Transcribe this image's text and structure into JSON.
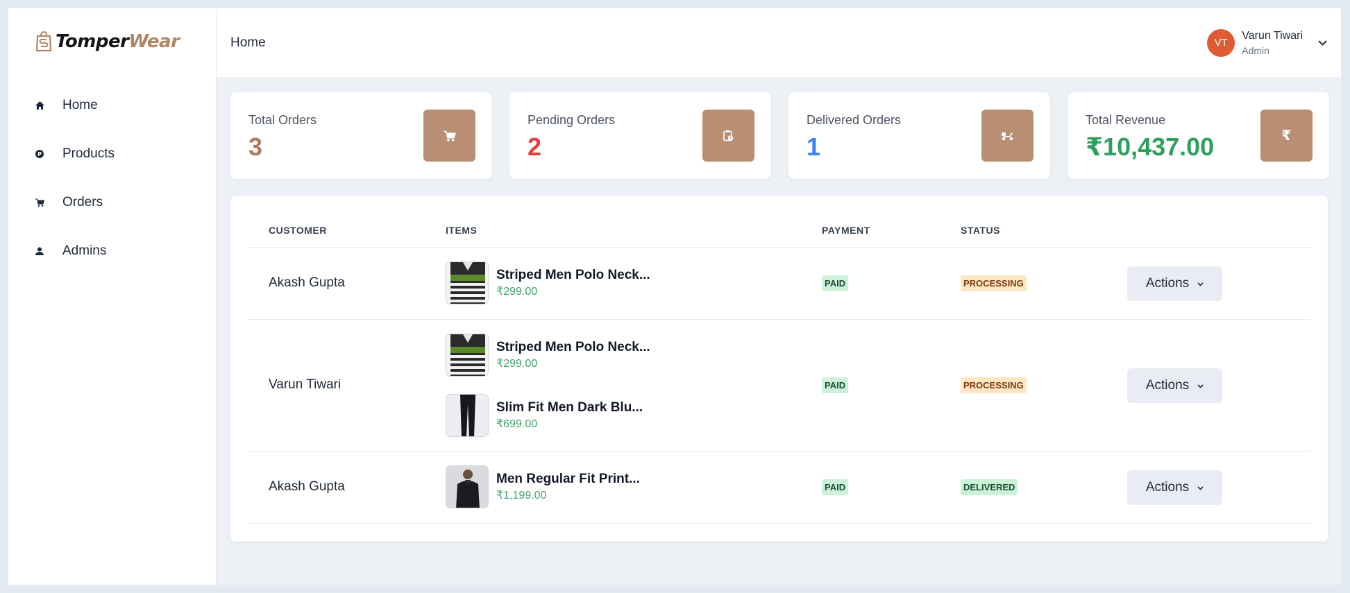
{
  "brand": {
    "part1": "Tomper",
    "part2": "Wear"
  },
  "sidebar": {
    "items": [
      {
        "label": "Home",
        "icon": "home-icon"
      },
      {
        "label": "Products",
        "icon": "products-icon"
      },
      {
        "label": "Orders",
        "icon": "cart-icon"
      },
      {
        "label": "Admins",
        "icon": "user-icon"
      }
    ]
  },
  "header": {
    "breadcrumb": "Home",
    "user": {
      "initials": "VT",
      "name": "Varun Tiwari",
      "role": "Admin"
    }
  },
  "stats": [
    {
      "title": "Total Orders",
      "value": "3",
      "color": "#b07a5a",
      "icon": "cart-icon"
    },
    {
      "title": "Pending Orders",
      "value": "2",
      "color": "#e53e3e",
      "icon": "clipboard-clock-icon"
    },
    {
      "title": "Delivered Orders",
      "value": "1",
      "color": "#3b82f6",
      "icon": "delivery-scooter-icon"
    },
    {
      "title": "Total Revenue",
      "value": "₹10,437.00",
      "color": "#2f9e5e",
      "icon": "rupee-icon",
      "icon_glyph": "₹"
    }
  ],
  "table": {
    "headers": {
      "customer": "CUSTOMER",
      "items": "ITEMS",
      "payment": "PAYMENT",
      "status": "STATUS"
    },
    "action_label": "Actions",
    "rows": [
      {
        "customer": "Akash Gupta",
        "items": [
          {
            "name": "Striped Men Polo Neck...",
            "price": "₹299.00",
            "thumb": "striped-polo-thumbnail"
          }
        ],
        "payment": "PAID",
        "status": "PROCESSING"
      },
      {
        "customer": "Varun Tiwari",
        "items": [
          {
            "name": "Striped Men Polo Neck...",
            "price": "₹299.00",
            "thumb": "striped-polo-thumbnail"
          },
          {
            "name": "Slim Fit Men Dark Blu...",
            "price": "₹699.00",
            "thumb": "dark-jeans-thumbnail"
          }
        ],
        "payment": "PAID",
        "status": "PROCESSING"
      },
      {
        "customer": "Akash Gupta",
        "items": [
          {
            "name": "Men Regular Fit Print...",
            "price": "₹1,199.00",
            "thumb": "black-shirt-thumbnail"
          }
        ],
        "payment": "PAID",
        "status": "DELIVERED"
      }
    ]
  },
  "colors": {
    "accent": "#b98f73",
    "avatar": "#e05a32",
    "price_green": "#3ea36b"
  }
}
